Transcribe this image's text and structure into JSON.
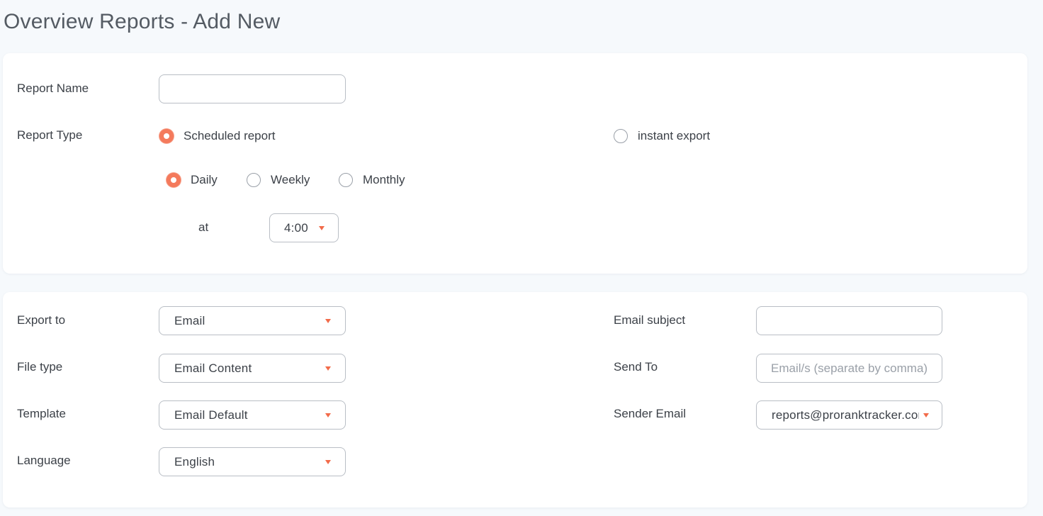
{
  "page": {
    "title": "Overview Reports - Add New"
  },
  "report": {
    "name_label": "Report Name",
    "name_value": "",
    "type_label": "Report Type",
    "type_options": [
      {
        "label": "Scheduled report",
        "checked": true
      },
      {
        "label": "instant export",
        "checked": false
      }
    ],
    "frequency_options": [
      {
        "label": "Daily",
        "checked": true
      },
      {
        "label": "Weekly",
        "checked": false
      },
      {
        "label": "Monthly",
        "checked": false
      }
    ],
    "at_label": "at",
    "time_value": "4:00"
  },
  "export": {
    "export_to_label": "Export to",
    "export_to_value": "Email",
    "file_type_label": "File type",
    "file_type_value": "Email Content",
    "template_label": "Template",
    "template_value": "Email Default",
    "language_label": "Language",
    "language_value": "English",
    "email_subject_label": "Email subject",
    "email_subject_value": "",
    "send_to_label": "Send To",
    "send_to_placeholder": "Email/s (separate by comma)",
    "sender_email_label": "Sender Email",
    "sender_email_value": "reports@proranktracker.com"
  },
  "colors": {
    "accent": "#f47a5c",
    "caret": "#f26b4a",
    "border": "#b9bec5",
    "background": "#f6f9fc"
  },
  "icons": {
    "dropdown": "caret-down-icon",
    "radio": "radio-button-icon"
  }
}
